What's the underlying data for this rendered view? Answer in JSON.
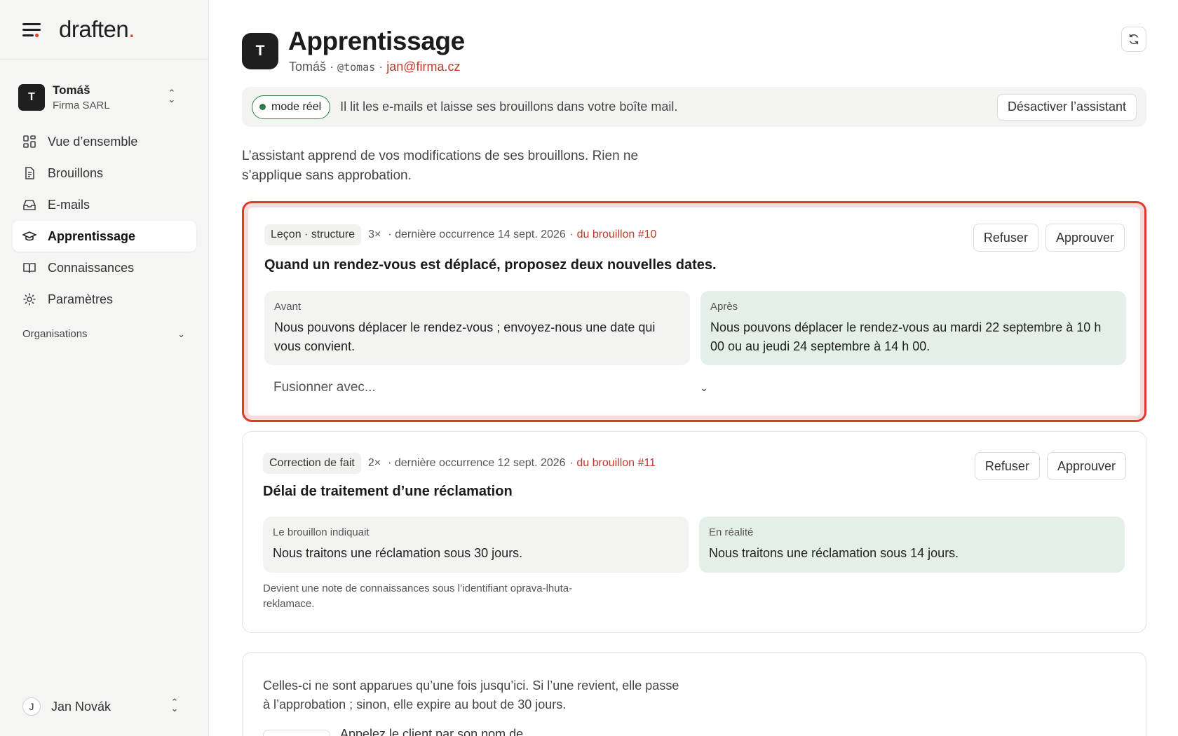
{
  "brand": {
    "name": "draften",
    "dot": "."
  },
  "account": {
    "initial": "T",
    "name": "Tomáš",
    "org": "Firma SARL"
  },
  "nav": [
    {
      "label": "Vue d’ensemble",
      "icon": "layout-grid-icon"
    },
    {
      "label": "Brouillons",
      "icon": "document-icon"
    },
    {
      "label": "E-mails",
      "icon": "inbox-icon"
    },
    {
      "label": "Apprentissage",
      "icon": "graduation-cap-icon",
      "active": true
    },
    {
      "label": "Connaissances",
      "icon": "book-icon"
    },
    {
      "label": "Paramètres",
      "icon": "gear-icon"
    }
  ],
  "organisations": {
    "label": "Organisations"
  },
  "user": {
    "initial": "J",
    "name": "Jan Novák"
  },
  "header": {
    "initial": "T",
    "title": "Apprentissage",
    "name": "Tomáš",
    "sep": "·",
    "handle": "@tomas",
    "email": "jan@firma.cz"
  },
  "status": {
    "mode": "mode réel",
    "text": "Il lit les e-mails et laisse ses brouillons dans votre boîte mail.",
    "deactivate": "Désactiver l’assistant"
  },
  "intro": "L’assistant apprend de vos modifications de ses brouillons. Rien ne s’applique sans approbation.",
  "cards": [
    {
      "tag": "Leçon · structure",
      "count": "3×",
      "last": "· dernière occurrence 14 sept. 2026",
      "source": "· du brouillon #10",
      "title": "Quand un rendez-vous est déplacé, proposez deux nouvelles dates.",
      "before_label": "Avant",
      "before_text": "Nous pouvons déplacer le rendez-vous ; envoyez-nous une date qui vous convient.",
      "after_label": "Après",
      "after_text": "Nous pouvons déplacer le rendez-vous au mardi 22 septembre à 10 h 00 ou au jeudi 24 septembre à 14 h 00.",
      "merge": "Fusionner avec...",
      "refuse": "Refuser",
      "approve": "Approuver"
    },
    {
      "tag": "Correction de fait",
      "count": "2×",
      "last": "· dernière occurrence 12 sept. 2026",
      "source": "· du brouillon #11",
      "title": "Délai de traitement d’une réclamation",
      "before_label": "Le brouillon indiquait",
      "before_text": "Nous traitons une réclamation sous 30 jours.",
      "after_label": "En réalité",
      "after_text": "Nous traitons une réclamation sous 14 jours.",
      "note": "Devient une note de connaissances sous l’identifiant oprava-lhuta-reklamace.",
      "refuse": "Refuser",
      "approve": "Approuver"
    }
  ],
  "pending": {
    "text": "Celles-ci ne sont apparues qu’une fois jusqu’ici. Si l’une revient, elle passe à l’approbation ; sinon, elle expire au bout de 30 jours.",
    "row_text": "Appelez le client par son nom de"
  }
}
